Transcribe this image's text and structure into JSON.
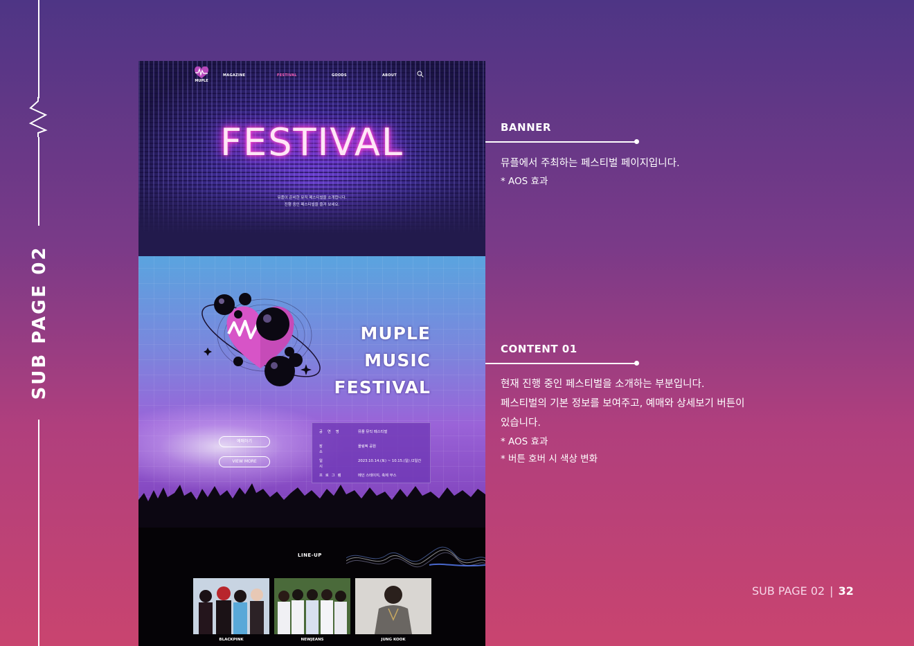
{
  "rail": {
    "title": "SUB PAGE 02"
  },
  "mockup": {
    "nav": {
      "logo_text": "MUPLE",
      "items": [
        "MAGAZINE",
        "FESTIVAL",
        "GOODS",
        "ABOUT"
      ]
    },
    "banner": {
      "title": "FESTIVAL",
      "desc_line1": "뮤플이 준비한 뮤직 페스티벌을 소개합니다.",
      "desc_line2": "진행 중인 페스티벌을 즐겨 보세요."
    },
    "content": {
      "festival_name": [
        "MUPLE",
        "MUSIC",
        "FESTIVAL"
      ],
      "reserve_button": "예매하기",
      "more_button": "VIEW MORE",
      "info": [
        {
          "key": "공연명",
          "value": "뮤플 뮤직 페스티벌"
        },
        {
          "key": "장소",
          "value": "올림픽 공원"
        },
        {
          "key": "일시",
          "value": "2023.10.14.(토) ~ 10.15.(일) /2일간"
        },
        {
          "key": "프로그램",
          "value": "메인 스테이지, 축제 부스"
        }
      ]
    },
    "lineup": {
      "title": "LINE-UP",
      "artists": [
        {
          "name": "BLACKPINK"
        },
        {
          "name": "NEWJEANS"
        },
        {
          "name": "JUNG KOOK"
        }
      ]
    }
  },
  "sections": {
    "banner": {
      "title": "BANNER",
      "text": "뮤플에서 주최하는 페스티벌 페이지입니다.",
      "note": "* AOS 효과"
    },
    "content01": {
      "title": "CONTENT 01",
      "line1": "현재 진행 중인 페스티벌을 소개하는 부분입니다.",
      "line2": "페스티벌의 기본 정보를 보여주고, 예매와 상세보기 버튼이",
      "line3": "있습니다.",
      "note1": "* AOS 효과",
      "note2": "* 버튼 호버 시 색상 변화"
    }
  },
  "footer": {
    "label": "SUB PAGE 02",
    "page": "32"
  }
}
